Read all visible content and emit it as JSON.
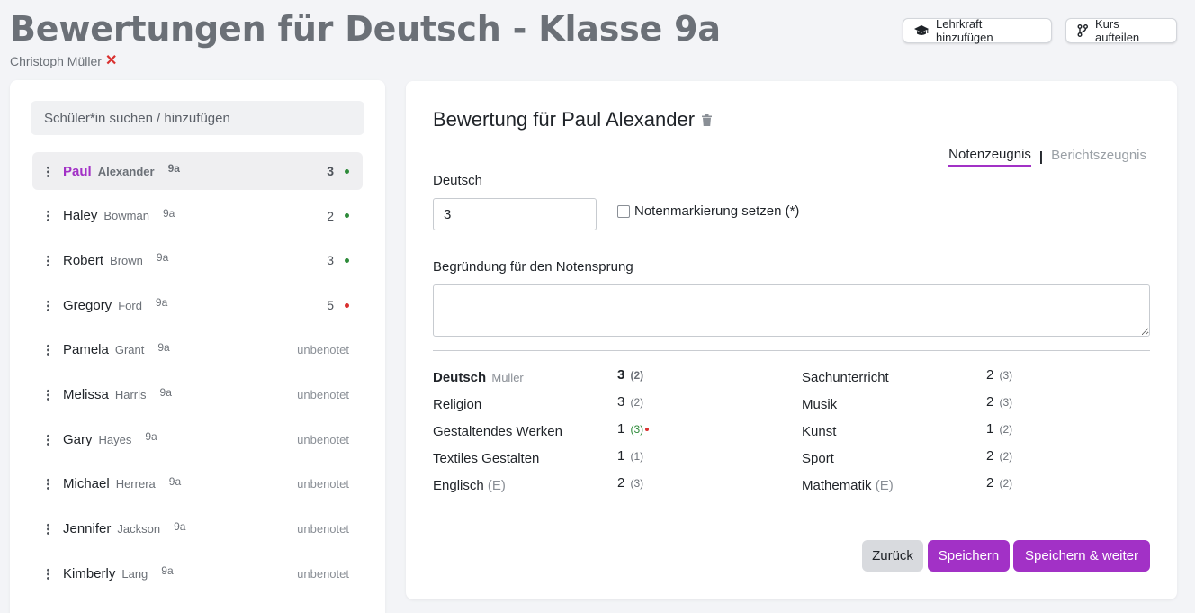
{
  "header": {
    "title": "Bewertungen für Deutsch - Klasse 9a",
    "teacher": "Christoph Müller",
    "remove_icon": "✕",
    "add_teacher_label": "Lehrkraft hinzufügen",
    "split_course_label": "Kurs aufteilen"
  },
  "sidebar": {
    "search_placeholder": "Schüler*in suchen / hinzufügen",
    "students": [
      {
        "first": "Paul",
        "last": "Alexander",
        "class": "9a",
        "grade": "3",
        "status": "green",
        "active": true
      },
      {
        "first": "Haley",
        "last": "Bowman",
        "class": "9a",
        "grade": "2",
        "status": "green"
      },
      {
        "first": "Robert",
        "last": "Brown",
        "class": "9a",
        "grade": "3",
        "status": "green"
      },
      {
        "first": "Gregory",
        "last": "Ford",
        "class": "9a",
        "grade": "5",
        "status": "red"
      },
      {
        "first": "Pamela",
        "last": "Grant",
        "class": "9a",
        "grade": "unbenotet"
      },
      {
        "first": "Melissa",
        "last": "Harris",
        "class": "9a",
        "grade": "unbenotet"
      },
      {
        "first": "Gary",
        "last": "Hayes",
        "class": "9a",
        "grade": "unbenotet"
      },
      {
        "first": "Michael",
        "last": "Herrera",
        "class": "9a",
        "grade": "unbenotet"
      },
      {
        "first": "Jennifer",
        "last": "Jackson",
        "class": "9a",
        "grade": "unbenotet"
      },
      {
        "first": "Kimberly",
        "last": "Lang",
        "class": "9a",
        "grade": "unbenotet"
      }
    ]
  },
  "evaluation": {
    "title": "Bewertung für Paul Alexander",
    "tabs": {
      "active": "Notenzeugnis",
      "separator": "|",
      "inactive": "Berichtszeugnis"
    },
    "subject_label": "Deutsch",
    "grade_value": "3",
    "mark_label": "Notenmarkierung setzen (*)",
    "reason_label": "Begründung für den Notensprung",
    "subjects_left": [
      {
        "name": "Deutsch",
        "teacher": "Müller",
        "grade": "3",
        "prev": "(2)",
        "main": true
      },
      {
        "name": "Religion",
        "grade": "3",
        "prev": "(2)"
      },
      {
        "name": "Gestaltendes Werken",
        "grade": "1",
        "prev": "(3)",
        "flag": true
      },
      {
        "name": "Textiles Gestalten",
        "grade": "1",
        "prev": "(1)"
      },
      {
        "name": "Englisch",
        "suffix": "(E)",
        "grade": "2",
        "prev": "(3)"
      }
    ],
    "subjects_right": [
      {
        "name": "Sachunterricht",
        "grade": "2",
        "prev": "(3)"
      },
      {
        "name": "Musik",
        "grade": "2",
        "prev": "(3)"
      },
      {
        "name": "Kunst",
        "grade": "1",
        "prev": "(2)"
      },
      {
        "name": "Sport",
        "grade": "2",
        "prev": "(2)"
      },
      {
        "name": "Mathematik",
        "suffix": "(E)",
        "grade": "2",
        "prev": "(2)"
      }
    ],
    "back_label": "Zurück",
    "save_label": "Speichern",
    "save_next_label": "Speichern & weiter"
  },
  "colors": {
    "accent": "#a231c6",
    "green": "#2e8b3a",
    "red": "#d9302f"
  }
}
